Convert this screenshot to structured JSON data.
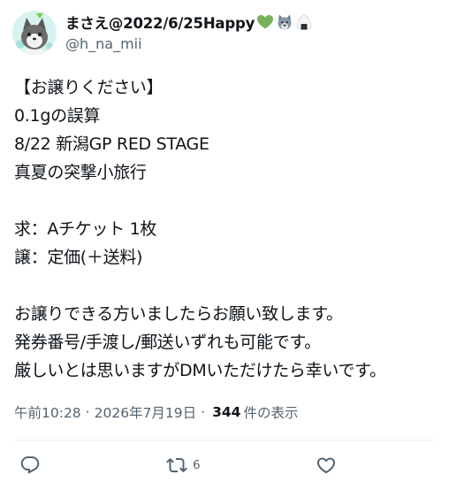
{
  "user": {
    "display_name": "まさえ@2022/6/25Happy",
    "handle": "@h_na_mii",
    "name_emojis": [
      "green-heart-icon",
      "wolf-icon",
      "rice-ball-icon"
    ]
  },
  "tweet": {
    "lines": [
      "【お譲りください】",
      "0.1gの誤算",
      "8/22 新潟GP RED STAGE",
      "真夏の突撃小旅行",
      "",
      "求：Aチケット 1枚",
      "譲：定価(＋送料)",
      "",
      "お譲りできる方いましたらお願い致します。",
      "発券番号/手渡し/郵送いずれも可能です。",
      "厳しいとは思いますがDMいただけたら幸いです。"
    ]
  },
  "meta": {
    "time": "午前10:28",
    "separator": "·",
    "date": "2026年7月19日",
    "views_count": "344",
    "views_label": "件の表示"
  },
  "actions": {
    "retweet_count": "6"
  },
  "colors": {
    "text": "#0f1419",
    "secondary": "#536471",
    "heart_emoji": "#78b159",
    "avatar_bg": "#d8f3ef"
  }
}
